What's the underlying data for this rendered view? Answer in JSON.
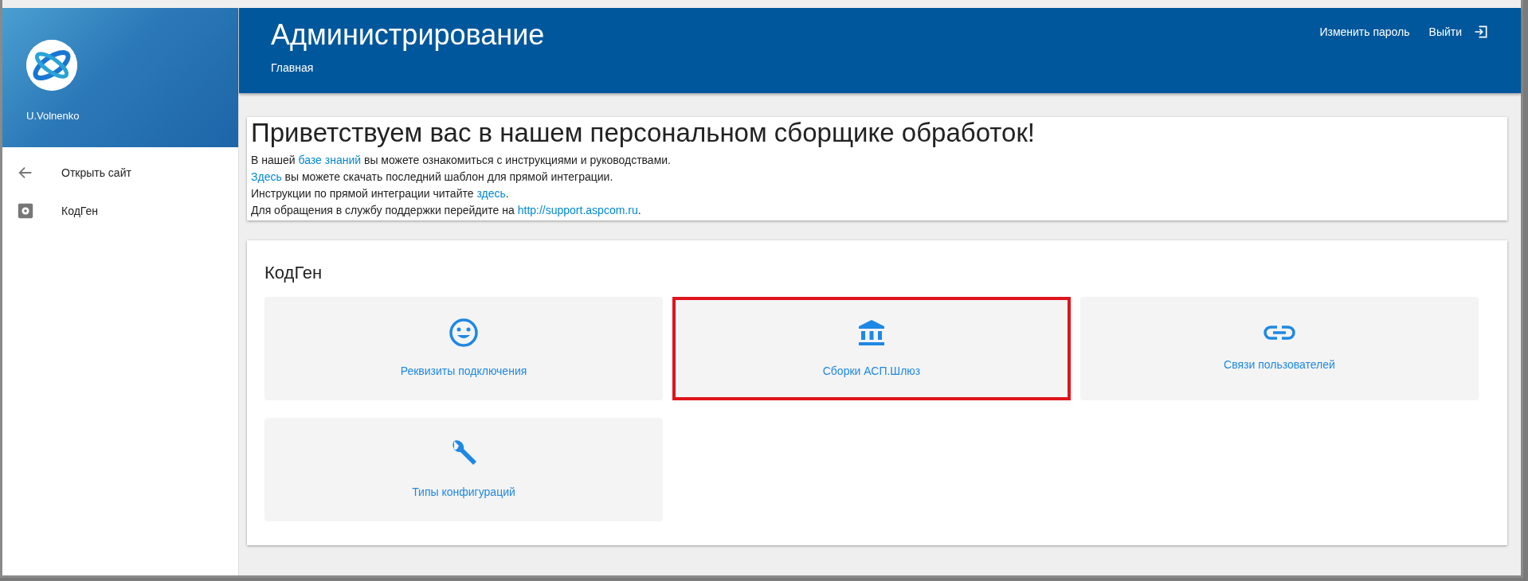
{
  "sidebar": {
    "user": "U.Volnenko",
    "items": [
      {
        "label": "Открыть сайт",
        "kind": "back"
      },
      {
        "label": "КодГен",
        "kind": "module"
      }
    ]
  },
  "header": {
    "title": "Администрирование",
    "breadcrumb": "Главная",
    "actions": [
      {
        "label": "Изменить пароль",
        "kind": "plain"
      },
      {
        "label": "Выйти",
        "kind": "exit"
      }
    ]
  },
  "welcome": {
    "heading": "Приветствуем вас в нашем персональном сборщике обработок!",
    "lines": [
      [
        {
          "text": "В нашей ",
          "link": false
        },
        {
          "text": "базе знаний",
          "link": true
        },
        {
          "text": " вы можете ознакомиться с инструкциями и руководствами.",
          "link": false
        }
      ],
      [
        {
          "text": "Здесь",
          "link": true
        },
        {
          "text": " вы можете скачать последний шаблон для прямой интеграции.",
          "link": false
        }
      ],
      [
        {
          "text": "Инструкции по прямой интеграции читайте ",
          "link": false
        },
        {
          "text": "здесь",
          "link": true
        },
        {
          "text": ".",
          "link": false
        }
      ],
      [
        {
          "text": "Для обращения в службу поддержки перейдите на ",
          "link": false
        },
        {
          "text": "http://support.aspcom.ru",
          "link": true
        },
        {
          "text": ".",
          "link": false
        }
      ]
    ]
  },
  "section": {
    "title": "КодГен",
    "tiles": [
      {
        "label": "Реквизиты подключения",
        "kind": "credentials",
        "highlighted": false
      },
      {
        "label": "Сборки АСП.Шлюз",
        "kind": "builds",
        "highlighted": true
      },
      {
        "label": "Связи пользователей",
        "kind": "relations",
        "highlighted": false
      },
      {
        "label": "Типы конфигураций",
        "kind": "config",
        "highlighted": false
      }
    ]
  }
}
